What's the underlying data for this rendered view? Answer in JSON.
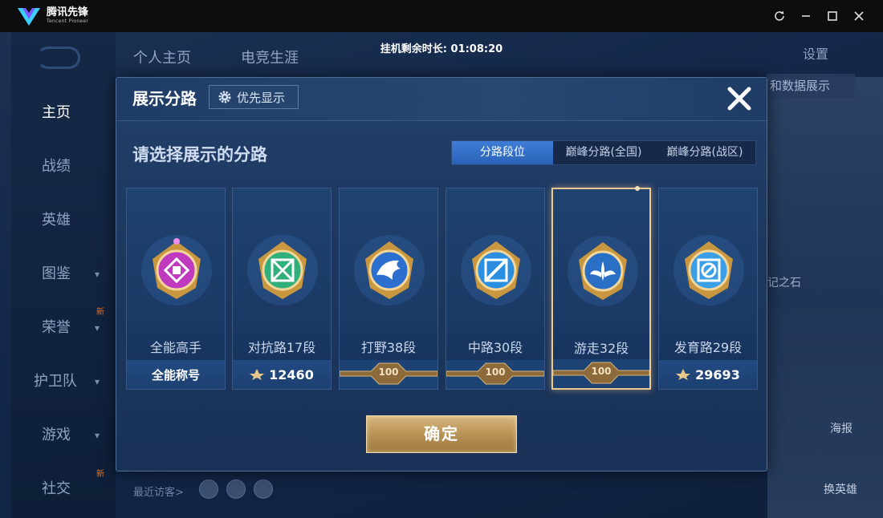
{
  "titlebar": {
    "app_name": "腾讯先锋",
    "app_sub": "Tencent Pioneer",
    "controls": [
      "refresh-icon",
      "minimize-icon",
      "maximize-icon",
      "close-icon"
    ]
  },
  "timer": "挂机剩余时长: 01:08:20",
  "background": {
    "sidebar": [
      {
        "label": "主页"
      },
      {
        "label": "战绩"
      },
      {
        "label": "英雄"
      },
      {
        "label": "图鉴"
      },
      {
        "label": "荣誉"
      },
      {
        "label": "护卫队"
      },
      {
        "label": "游戏"
      },
      {
        "label": "社交"
      }
    ],
    "new_badge": "新",
    "top_nav": [
      "个人主页",
      "电竞生涯"
    ],
    "settings": "设置",
    "right_strip": "和数据展示",
    "stone": "记之石",
    "poster": "海报",
    "swap_hero": "换英雄",
    "recent_visitors": "最近访客>"
  },
  "dialog": {
    "title": "展示分路",
    "priority_button": "优先显示",
    "subtitle": "请选择展示的分路",
    "tabs": [
      {
        "label": "分路段位",
        "active": true
      },
      {
        "label": "巅峰分路(全国)",
        "active": false
      },
      {
        "label": "巅峰分路(战区)",
        "active": false
      }
    ],
    "cards": [
      {
        "label": "全能高手",
        "bottom": "全能称号",
        "kind": "title",
        "emblem": "all-round-emblem-icon",
        "color": "#c03ac0",
        "selected": false
      },
      {
        "label": "对抗路17段",
        "bottom": "12460",
        "kind": "points",
        "emblem": "clash-lane-emblem-icon",
        "color": "#2fb07a",
        "selected": false
      },
      {
        "label": "打野38段",
        "bottom": "100",
        "kind": "rank",
        "emblem": "jungle-emblem-icon",
        "color": "#2b6fcf",
        "selected": false
      },
      {
        "label": "中路30段",
        "bottom": "100",
        "kind": "rank",
        "emblem": "mid-lane-emblem-icon",
        "color": "#2a8fe0",
        "selected": false
      },
      {
        "label": "游走32段",
        "bottom": "100",
        "kind": "rank",
        "emblem": "roam-emblem-icon",
        "color": "#2a6fc6",
        "selected": true
      },
      {
        "label": "发育路29段",
        "bottom": "29693",
        "kind": "points",
        "emblem": "farm-lane-emblem-icon",
        "color": "#3a9fe6",
        "selected": false
      }
    ],
    "confirm": "确定"
  }
}
